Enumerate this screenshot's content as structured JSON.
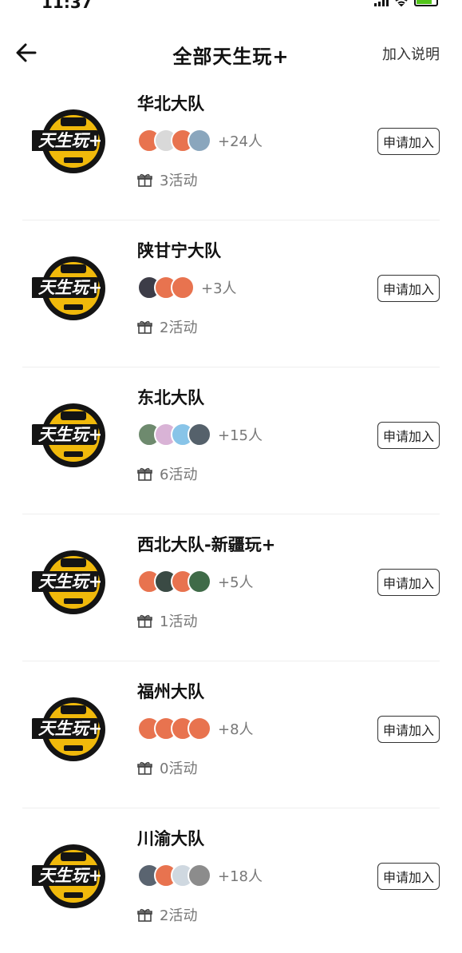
{
  "status": {
    "time": "11:37"
  },
  "header": {
    "title": "全部天生玩+",
    "action": "加入说明"
  },
  "logo_text": "天生玩+",
  "join_label": "申请加入",
  "teams": [
    {
      "name": "华北大队",
      "members": "+24人",
      "activities": "3活动",
      "avatars": [
        "#e8734f",
        "#d9d9d9",
        "#e8734f",
        "#8aa6bd"
      ]
    },
    {
      "name": "陕甘宁大队",
      "members": "+3人",
      "activities": "2活动",
      "avatars": [
        "#3d3d48",
        "#e8734f",
        "#e8734f"
      ]
    },
    {
      "name": "东北大队",
      "members": "+15人",
      "activities": "6活动",
      "avatars": [
        "#6e8a6e",
        "#d9b3d6",
        "#88c4e8",
        "#55616b"
      ]
    },
    {
      "name": "西北大队-新疆玩+",
      "members": "+5人",
      "activities": "1活动",
      "avatars": [
        "#e8734f",
        "#3a4a44",
        "#e8734f",
        "#3f6b48"
      ]
    },
    {
      "name": "福州大队",
      "members": "+8人",
      "activities": "0活动",
      "avatars": [
        "#e8734f",
        "#e8734f",
        "#e8734f",
        "#e8734f"
      ]
    },
    {
      "name": "川渝大队",
      "members": "+18人",
      "activities": "2活动",
      "avatars": [
        "#5a6470",
        "#e8734f",
        "#cfd8e0",
        "#8c8c8c"
      ]
    }
  ]
}
